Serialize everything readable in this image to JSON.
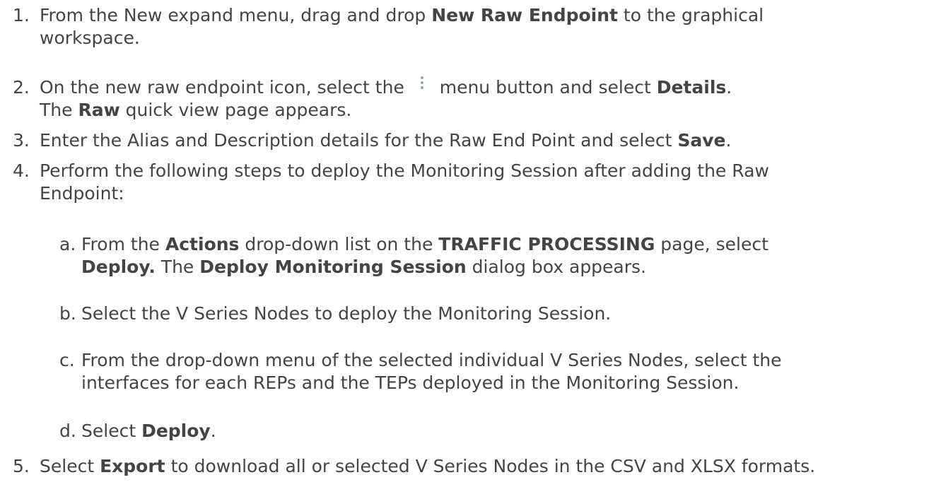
{
  "steps": [
    {
      "num": "1.",
      "parts": [
        "From the New expand menu, drag and drop ",
        "New Raw Endpoint",
        " to the graphical",
        "workspace."
      ]
    },
    {
      "num": "2.",
      "parts": [
        "On the new raw endpoint icon, select the ",
        " menu button and select ",
        "Details",
        ".",
        "The ",
        "Raw",
        " quick view page appears."
      ],
      "icon": "kebab-menu-icon"
    },
    {
      "num": "3.",
      "parts": [
        "Enter the Alias and Description details for the Raw End Point and select ",
        "Save",
        "."
      ]
    },
    {
      "num": "4.",
      "parts": [
        "Perform the following steps to deploy the Monitoring Session after adding the Raw",
        "Endpoint:"
      ]
    },
    {
      "num": "5.",
      "parts": [
        "Select ",
        "Export",
        " to download all or selected V Series Nodes in the CSV and XLSX formats."
      ]
    }
  ],
  "substeps": [
    {
      "num": "a.",
      "parts": [
        "From the ",
        "Actions",
        " drop-down list on the ",
        "TRAFFIC PROCESSING",
        " page, select",
        "Deploy.",
        " The ",
        "Deploy Monitoring Session",
        " dialog box appears."
      ]
    },
    {
      "num": "b.",
      "parts": [
        "Select the V Series Nodes to deploy the Monitoring Session."
      ]
    },
    {
      "num": "c.",
      "parts": [
        "From the drop-down menu of the selected individual V Series Nodes, select the",
        "interfaces for each REPs and the TEPs deployed in the Monitoring Session."
      ]
    },
    {
      "num": "d.",
      "parts": [
        "Select ",
        "Deploy",
        "."
      ]
    }
  ]
}
